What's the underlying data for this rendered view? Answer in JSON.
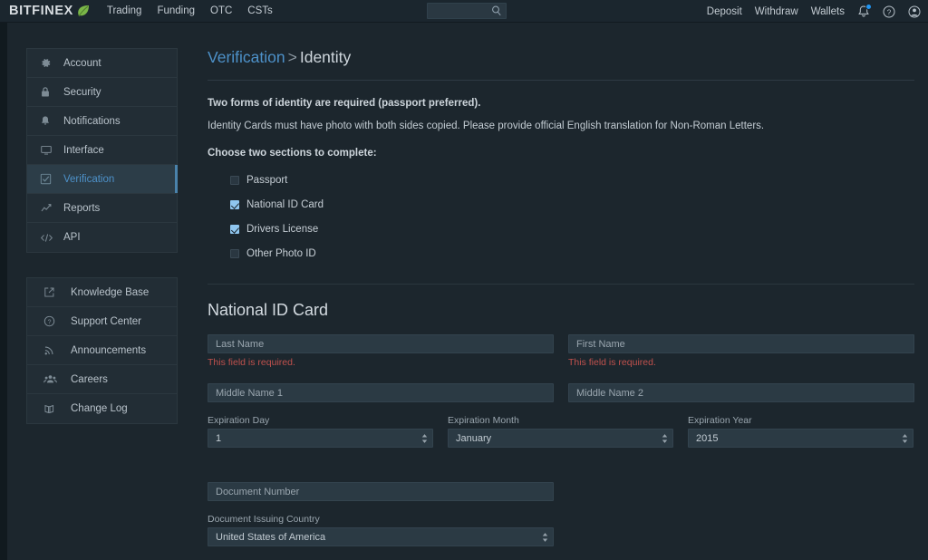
{
  "brand": {
    "name": "BITFINEX",
    "leaf_color": "#7ab648",
    "accent": "#4d91c9"
  },
  "topnav": {
    "links": [
      {
        "label": "Trading",
        "name": "nav-trading"
      },
      {
        "label": "Funding",
        "name": "nav-funding"
      },
      {
        "label": "OTC",
        "name": "nav-otc"
      },
      {
        "label": "CSTs",
        "name": "nav-csts"
      }
    ],
    "search": {
      "value": "",
      "placeholder": ""
    },
    "right_links": [
      {
        "label": "Deposit",
        "name": "nav-deposit"
      },
      {
        "label": "Withdraw",
        "name": "nav-withdraw"
      },
      {
        "label": "Wallets",
        "name": "nav-wallets"
      }
    ],
    "icons": {
      "bell": "bell-icon",
      "bell_badge_color": "#2196f3",
      "help": "help-circle-icon",
      "avatar": "user-avatar-icon",
      "search": "search-icon"
    }
  },
  "sidebar": {
    "primary": [
      {
        "label": "Account",
        "icon": "gear-icon",
        "active": false
      },
      {
        "label": "Security",
        "icon": "lock-icon",
        "active": false
      },
      {
        "label": "Notifications",
        "icon": "bell-icon",
        "active": false
      },
      {
        "label": "Interface",
        "icon": "monitor-icon",
        "active": false
      },
      {
        "label": "Verification",
        "icon": "checkbox-icon",
        "active": true
      },
      {
        "label": "Reports",
        "icon": "chart-line-icon",
        "active": false
      },
      {
        "label": "API",
        "icon": "code-icon",
        "active": false
      }
    ],
    "secondary": [
      {
        "label": "Knowledge Base",
        "icon": "external-link-icon"
      },
      {
        "label": "Support Center",
        "icon": "question-circle-icon"
      },
      {
        "label": "Announcements",
        "icon": "rss-icon"
      },
      {
        "label": "Careers",
        "icon": "users-icon"
      },
      {
        "label": "Change Log",
        "icon": "book-icon"
      }
    ]
  },
  "content": {
    "breadcrumb": {
      "parent": "Verification",
      "separator": ">",
      "current": "Identity"
    },
    "lead": "Two forms of identity are required (passport preferred).",
    "subtext": "Identity Cards must have photo with both sides copied. Please provide official English translation for Non-Roman Letters.",
    "choose_heading": "Choose two sections to complete:",
    "options": [
      {
        "label": "Passport",
        "checked": false
      },
      {
        "label": "National ID Card",
        "checked": true
      },
      {
        "label": "Drivers License",
        "checked": true
      },
      {
        "label": "Other Photo ID",
        "checked": false
      }
    ],
    "section_title": "National ID Card",
    "form": {
      "last_name": {
        "placeholder": "Last Name",
        "value": "",
        "error": "This field is required."
      },
      "first_name": {
        "placeholder": "First Name",
        "value": "",
        "error": "This field is required."
      },
      "middle_name_1": {
        "placeholder": "Middle Name 1",
        "value": ""
      },
      "middle_name_2": {
        "placeholder": "Middle Name 2",
        "value": ""
      },
      "expiration_day": {
        "label": "Expiration Day",
        "value": "1"
      },
      "expiration_month": {
        "label": "Expiration Month",
        "value": "January"
      },
      "expiration_year": {
        "label": "Expiration Year",
        "value": "2015"
      },
      "document_number": {
        "placeholder": "Document Number",
        "value": ""
      },
      "document_issuing_country": {
        "label": "Document Issuing Country",
        "value": "United States of America"
      }
    }
  }
}
